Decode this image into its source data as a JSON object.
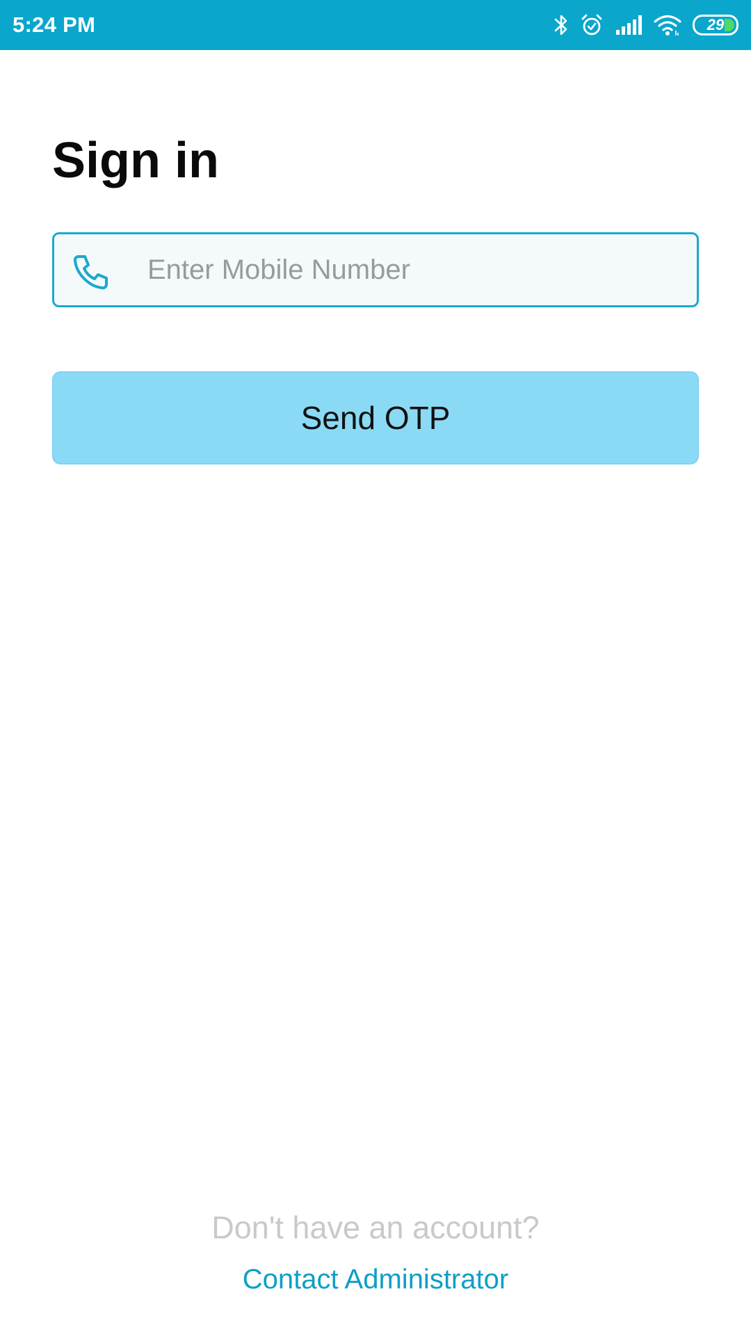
{
  "status_bar": {
    "time": "5:24 PM",
    "battery_level": "29",
    "icons": [
      "bluetooth-icon",
      "alarm-icon",
      "signal-icon",
      "wifi-icon",
      "battery-icon"
    ]
  },
  "title": "Sign in",
  "mobile_field": {
    "placeholder": "Enter Mobile Number",
    "value": "",
    "icon": "phone-icon"
  },
  "send_otp_label": "Send OTP",
  "footer": {
    "question": "Don't have an account?",
    "link": "Contact Administrator"
  },
  "colors": {
    "status_bar": "#0aa6cc",
    "accent": "#1aa9cc",
    "button_bg": "#8adaf6",
    "link": "#0e9fc5"
  }
}
